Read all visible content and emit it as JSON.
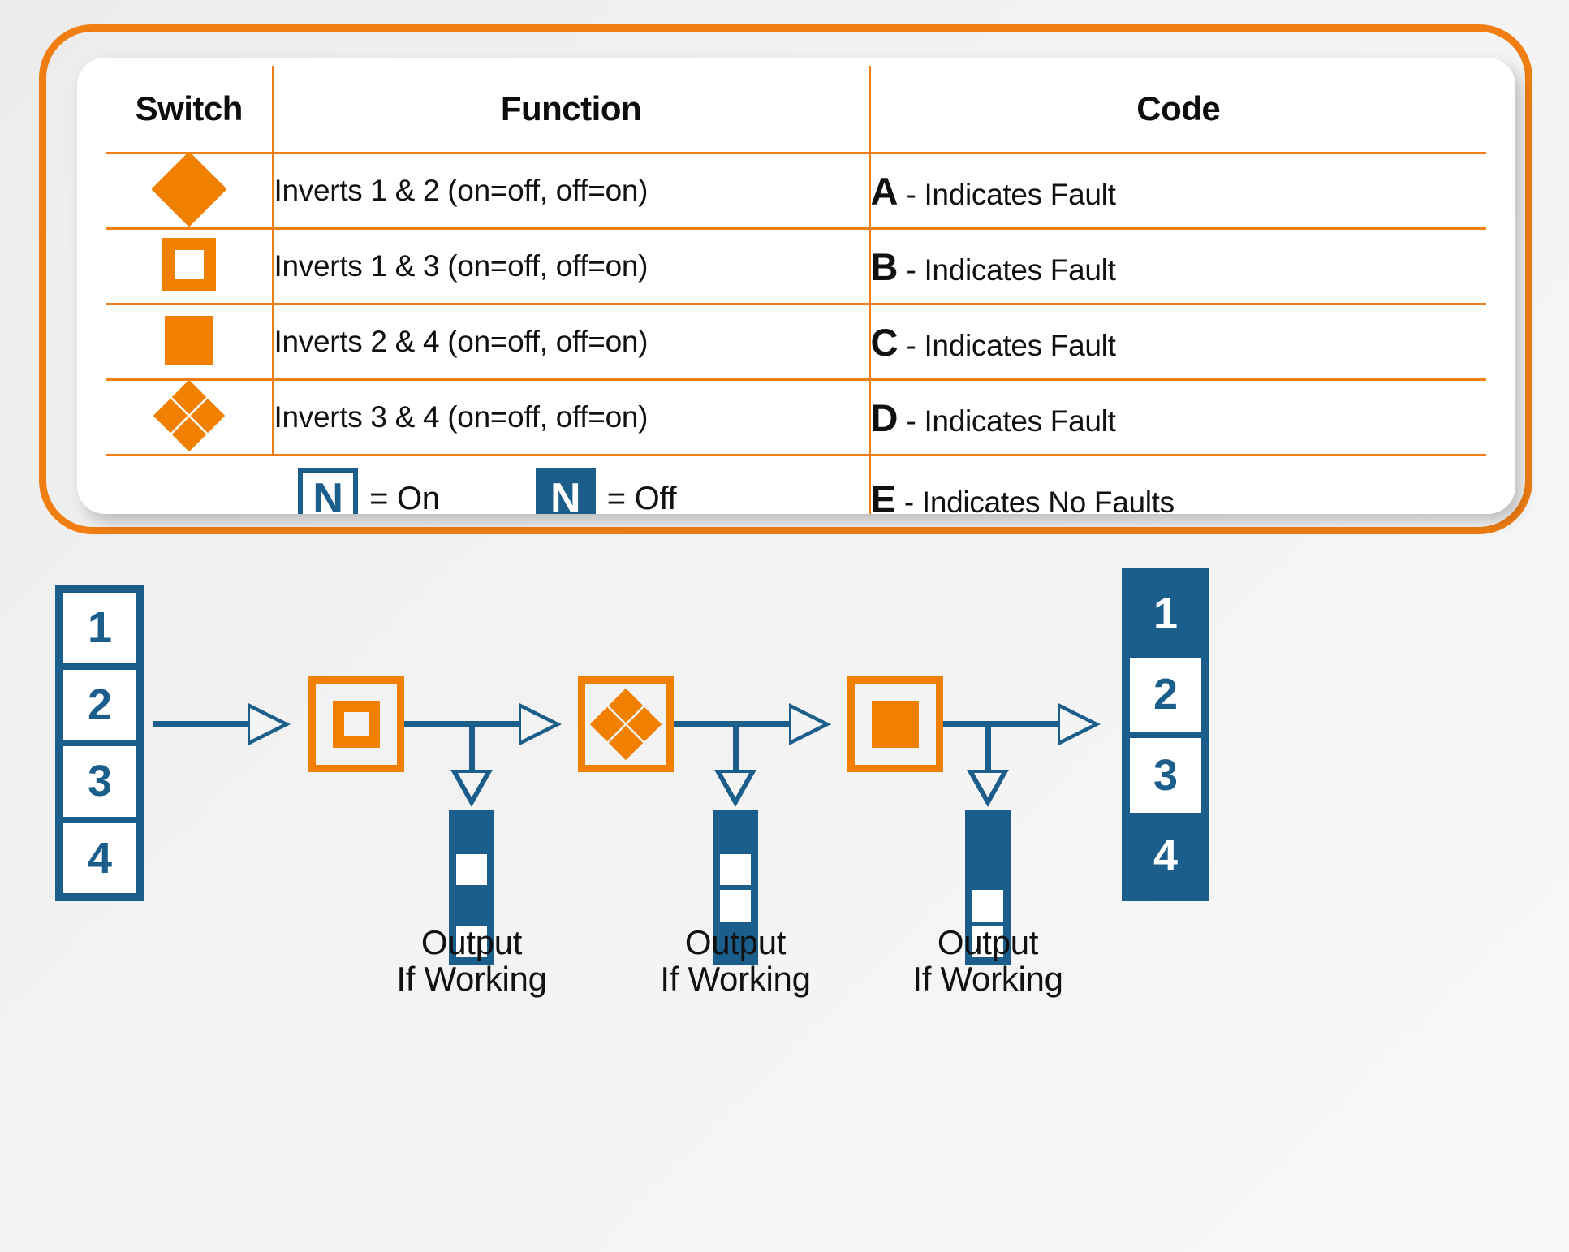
{
  "colors": {
    "orange": "#F28000",
    "orange_border": "#F07E13",
    "blue": "#1B5E8C",
    "white": "#FFFFFF",
    "text": "#111111",
    "page_bg": "#F1F1F1"
  },
  "legend": {
    "headers": {
      "switch": "Switch",
      "function": "Function",
      "code": "Code"
    },
    "rows": [
      {
        "glyph": "diamond-filled",
        "function": "Inverts 1 & 2 (on=off, off=on)",
        "code_letter": "A",
        "code_text": "- Indicates Fault"
      },
      {
        "glyph": "square-outline",
        "function": "Inverts 1 & 3 (on=off, off=on)",
        "code_letter": "B",
        "code_text": "- Indicates Fault"
      },
      {
        "glyph": "square-filled",
        "function": "Inverts 2 & 4 (on=off, off=on)",
        "code_letter": "C",
        "code_text": "- Indicates Fault"
      },
      {
        "glyph": "quad-diamond",
        "function": "Inverts 3 & 4 (on=off, off=on)",
        "code_letter": "D",
        "code_text": "- Indicates Fault"
      }
    ],
    "onoff": {
      "on_glyph_letter": "N",
      "on_label": "= On",
      "off_glyph_letter": "N",
      "off_label": "= Off"
    },
    "final_code": {
      "code_letter": "E",
      "code_text": "- Indicates No Faults"
    }
  },
  "diagram": {
    "input_column": {
      "name": "input-register",
      "bits": [
        {
          "label": "1",
          "state": "off"
        },
        {
          "label": "2",
          "state": "off"
        },
        {
          "label": "3",
          "state": "off"
        },
        {
          "label": "4",
          "state": "off"
        }
      ]
    },
    "output_column": {
      "name": "output-register",
      "bits": [
        {
          "label": "1",
          "state": "on"
        },
        {
          "label": "2",
          "state": "off"
        },
        {
          "label": "3",
          "state": "off"
        },
        {
          "label": "4",
          "state": "on"
        }
      ]
    },
    "gates": [
      {
        "name": "gate-1",
        "glyph": "square-outline"
      },
      {
        "name": "gate-2",
        "glyph": "quad-diamond"
      },
      {
        "name": "gate-3",
        "glyph": "square-filled"
      }
    ],
    "taps": [
      {
        "name": "tap-1",
        "label": "Output\nIf Working",
        "bits": [
          "on",
          "off",
          "on",
          "off"
        ]
      },
      {
        "name": "tap-2",
        "label": "Output\nIf Working",
        "bits": [
          "on",
          "off",
          "off",
          "on"
        ]
      },
      {
        "name": "tap-3",
        "label": "Output\nIf Working",
        "bits": [
          "on",
          "on",
          "off",
          "off"
        ]
      }
    ]
  }
}
